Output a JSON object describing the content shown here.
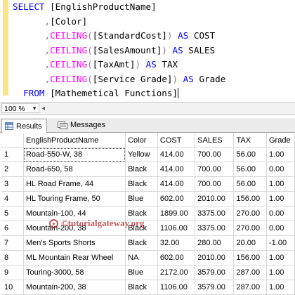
{
  "editor": {
    "lines": [
      [
        {
          "t": "SELECT ",
          "c": "kw"
        },
        {
          "t": "[EnglishProductName]",
          "c": ""
        }
      ],
      [
        {
          "t": "      ",
          "c": ""
        },
        {
          "t": ",",
          "c": "op"
        },
        {
          "t": "[Color]",
          "c": ""
        }
      ],
      [
        {
          "t": "      ",
          "c": ""
        },
        {
          "t": ",",
          "c": "op"
        },
        {
          "t": "CEILING",
          "c": "fn"
        },
        {
          "t": "(",
          "c": "op"
        },
        {
          "t": "[StandardCost]",
          "c": ""
        },
        {
          "t": ")",
          "c": "op"
        },
        {
          "t": " AS ",
          "c": "kw"
        },
        {
          "t": "COST",
          "c": ""
        }
      ],
      [
        {
          "t": "      ",
          "c": ""
        },
        {
          "t": ",",
          "c": "op"
        },
        {
          "t": "CEILING",
          "c": "fn"
        },
        {
          "t": "(",
          "c": "op"
        },
        {
          "t": "[SalesAmount]",
          "c": ""
        },
        {
          "t": ")",
          "c": "op"
        },
        {
          "t": " AS ",
          "c": "kw"
        },
        {
          "t": "SALES",
          "c": ""
        }
      ],
      [
        {
          "t": "      ",
          "c": ""
        },
        {
          "t": ",",
          "c": "op"
        },
        {
          "t": "CEILING",
          "c": "fn"
        },
        {
          "t": "(",
          "c": "op"
        },
        {
          "t": "[TaxAmt]",
          "c": ""
        },
        {
          "t": ")",
          "c": "op"
        },
        {
          "t": " AS ",
          "c": "kw"
        },
        {
          "t": "TAX",
          "c": ""
        }
      ],
      [
        {
          "t": "      ",
          "c": ""
        },
        {
          "t": ",",
          "c": "op"
        },
        {
          "t": "CEILING",
          "c": "fn"
        },
        {
          "t": "(",
          "c": "op"
        },
        {
          "t": "[Service Grade]",
          "c": ""
        },
        {
          "t": ")",
          "c": "op"
        },
        {
          "t": " AS ",
          "c": "kw"
        },
        {
          "t": "Grade",
          "c": ""
        }
      ],
      [
        {
          "t": "  FROM ",
          "c": "kw"
        },
        {
          "t": "[Mathemetical Functions]",
          "c": ""
        }
      ]
    ]
  },
  "zoom": {
    "value": "100 %"
  },
  "tabs": [
    {
      "label": "Results",
      "icon": "grid-icon",
      "active": true
    },
    {
      "label": "Messages",
      "icon": "message-icon",
      "active": false
    }
  ],
  "grid": {
    "columns": [
      "EnglishProductName",
      "Color",
      "COST",
      "SALES",
      "TAX",
      "Grade"
    ],
    "rows": [
      [
        "1",
        "Road-550-W, 38",
        "Yellow",
        "414.00",
        "700.00",
        "56.00",
        "1.00"
      ],
      [
        "2",
        "Road-650, 58",
        "Black",
        "414.00",
        "700.00",
        "56.00",
        "0.00"
      ],
      [
        "3",
        "HL Road Frame, 44",
        "Black",
        "414.00",
        "700.00",
        "56.00",
        "1.00"
      ],
      [
        "4",
        "HL Touring Frame, 50",
        "Blue",
        "602.00",
        "2010.00",
        "156.00",
        "1.00"
      ],
      [
        "5",
        "Mountain-100, 44",
        "Black",
        "1899.00",
        "3375.00",
        "270.00",
        "0.00"
      ],
      [
        "6",
        "Mountain-200, 38",
        "Black",
        "1106.00",
        "3375.00",
        "270.00",
        "0.00"
      ],
      [
        "7",
        "Men's Sports Shorts",
        "Black",
        "32.00",
        "280.00",
        "20.00",
        "-1.00"
      ],
      [
        "8",
        "ML Mountain Rear Wheel",
        "NA",
        "602.00",
        "2010.00",
        "156.00",
        "1.00"
      ],
      [
        "9",
        "Touring-3000, 58",
        "Blue",
        "2172.00",
        "3579.00",
        "287.00",
        "1.00"
      ],
      [
        "10",
        "Mountain-200, 38",
        "Black",
        "1106.00",
        "3579.00",
        "287.00",
        "1.00"
      ]
    ]
  },
  "watermark": {
    "text": "©tutorialgateway.org"
  },
  "colors": {
    "keyword": "#0000ff",
    "function": "#ff00ff",
    "operator": "#808080",
    "gutter": "#fbe38d",
    "watermark": "#b22828"
  }
}
